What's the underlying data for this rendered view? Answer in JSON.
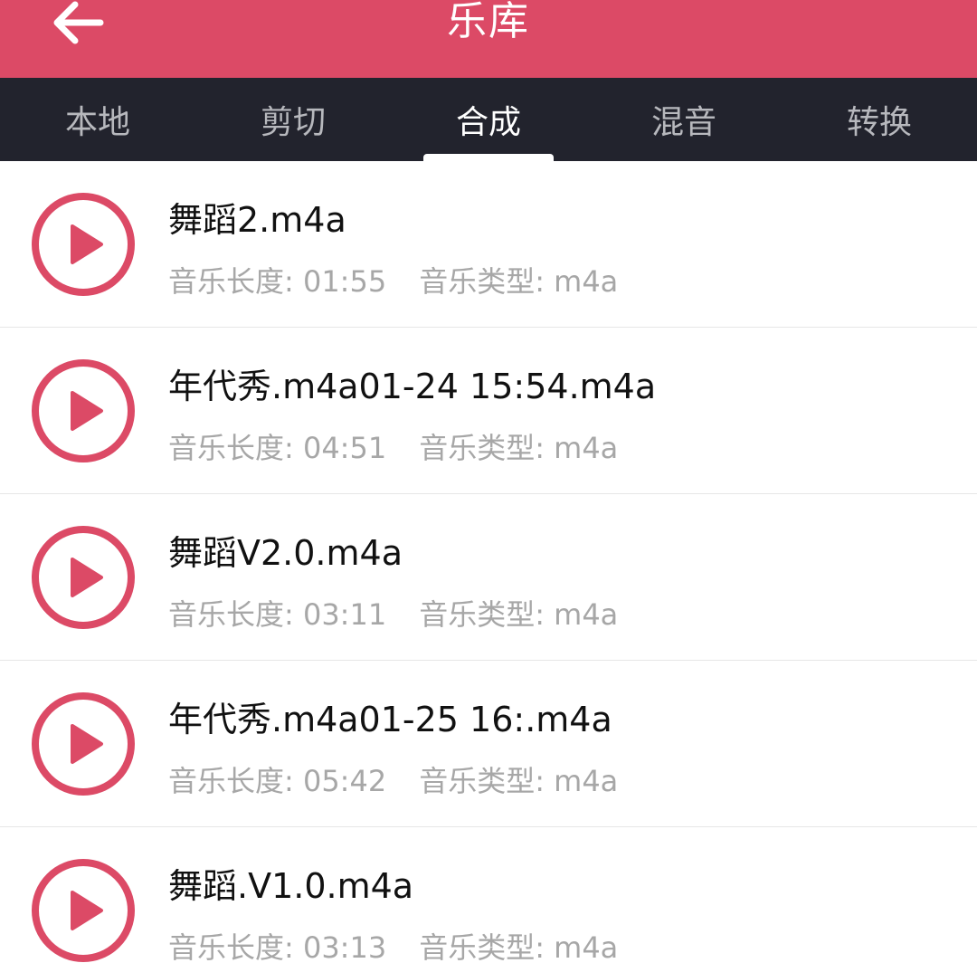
{
  "header": {
    "title": "乐库",
    "back_icon": "arrow-left-icon",
    "background": "#dc4a66"
  },
  "tabs": [
    {
      "label": "本地",
      "active": false
    },
    {
      "label": "剪切",
      "active": false
    },
    {
      "label": "合成",
      "active": true
    },
    {
      "label": "混音",
      "active": false
    },
    {
      "label": "转换",
      "active": false
    }
  ],
  "tabbar_background": "#22232d",
  "accent_color": "#dc4a66",
  "songs": [
    {
      "title": "舞蹈2.m4a",
      "length": "音乐长度: 01:55",
      "type": "音乐类型: m4a"
    },
    {
      "title": "年代秀.m4a01-24 15:54.m4a",
      "length": "音乐长度: 04:51",
      "type": "音乐类型: m4a"
    },
    {
      "title": "舞蹈V2.0.m4a",
      "length": "音乐长度: 03:11",
      "type": "音乐类型: m4a"
    },
    {
      "title": "年代秀.m4a01-25 16:.m4a",
      "length": "音乐长度: 05:42",
      "type": "音乐类型: m4a"
    },
    {
      "title": "舞蹈.V1.0.m4a",
      "length": "音乐长度: 03:13",
      "type": "音乐类型: m4a"
    }
  ],
  "row_icon": "play-circle-icon"
}
